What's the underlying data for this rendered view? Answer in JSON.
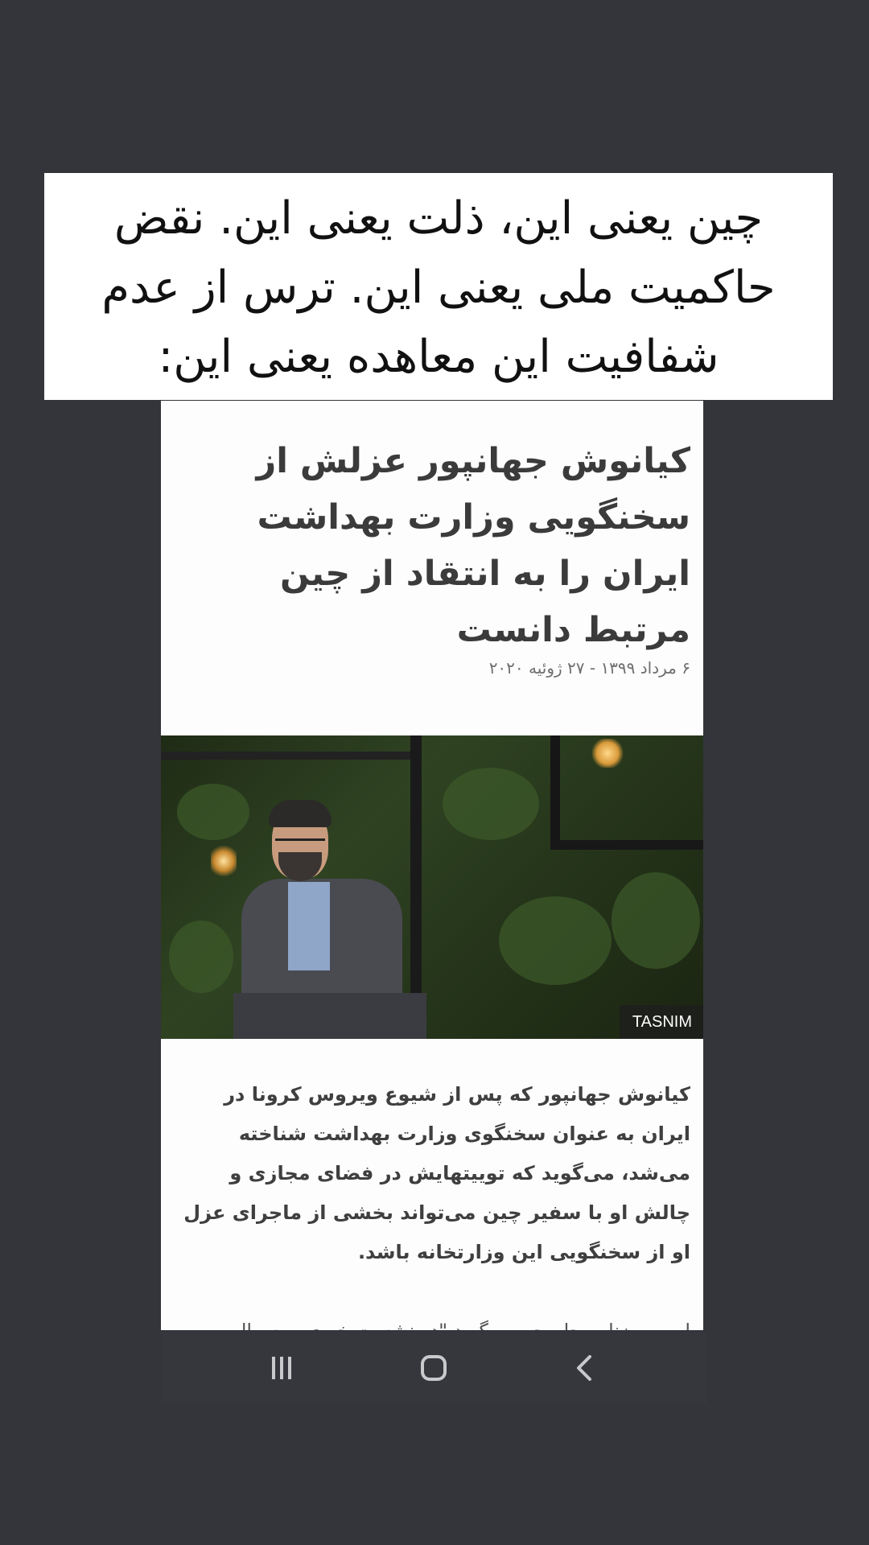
{
  "caption": {
    "text": "چین یعنی این، ذلت یعنی این. نقض حاکمیت ملی یعنی این. ترس از عدم شفافیت این معاهده یعنی این:"
  },
  "article": {
    "headline": "کیانوش جهانپور عزلش از سخنگویی وزارت بهداشت ایران را به انتقاد از چین مرتبط دانست",
    "date": "۶ مرداد ۱۳۹۹ - ۲۷ ژوئیه ۲۰۲۰",
    "photo_credit": "TASNIM",
    "body": "کیانوش جهانپور که پس از شیوع ویروس کرونا در ایران به عنوان سخنگوی وزارت بهداشت شناخته می‌شد، می‌گوید که توییتهایش در فضای مجازی و چالش او با سفیر چین می‌تواند بخشی از ماجرای عزل او از سخنگویی این وزارتخانه باشد.",
    "body_cut": "او به روزنامه جام جم می‌گوید \"در نشست خبری به سوال"
  },
  "navbar": {
    "recent_icon": "recent-apps-icon",
    "home_icon": "home-icon",
    "back_icon": "back-icon"
  }
}
